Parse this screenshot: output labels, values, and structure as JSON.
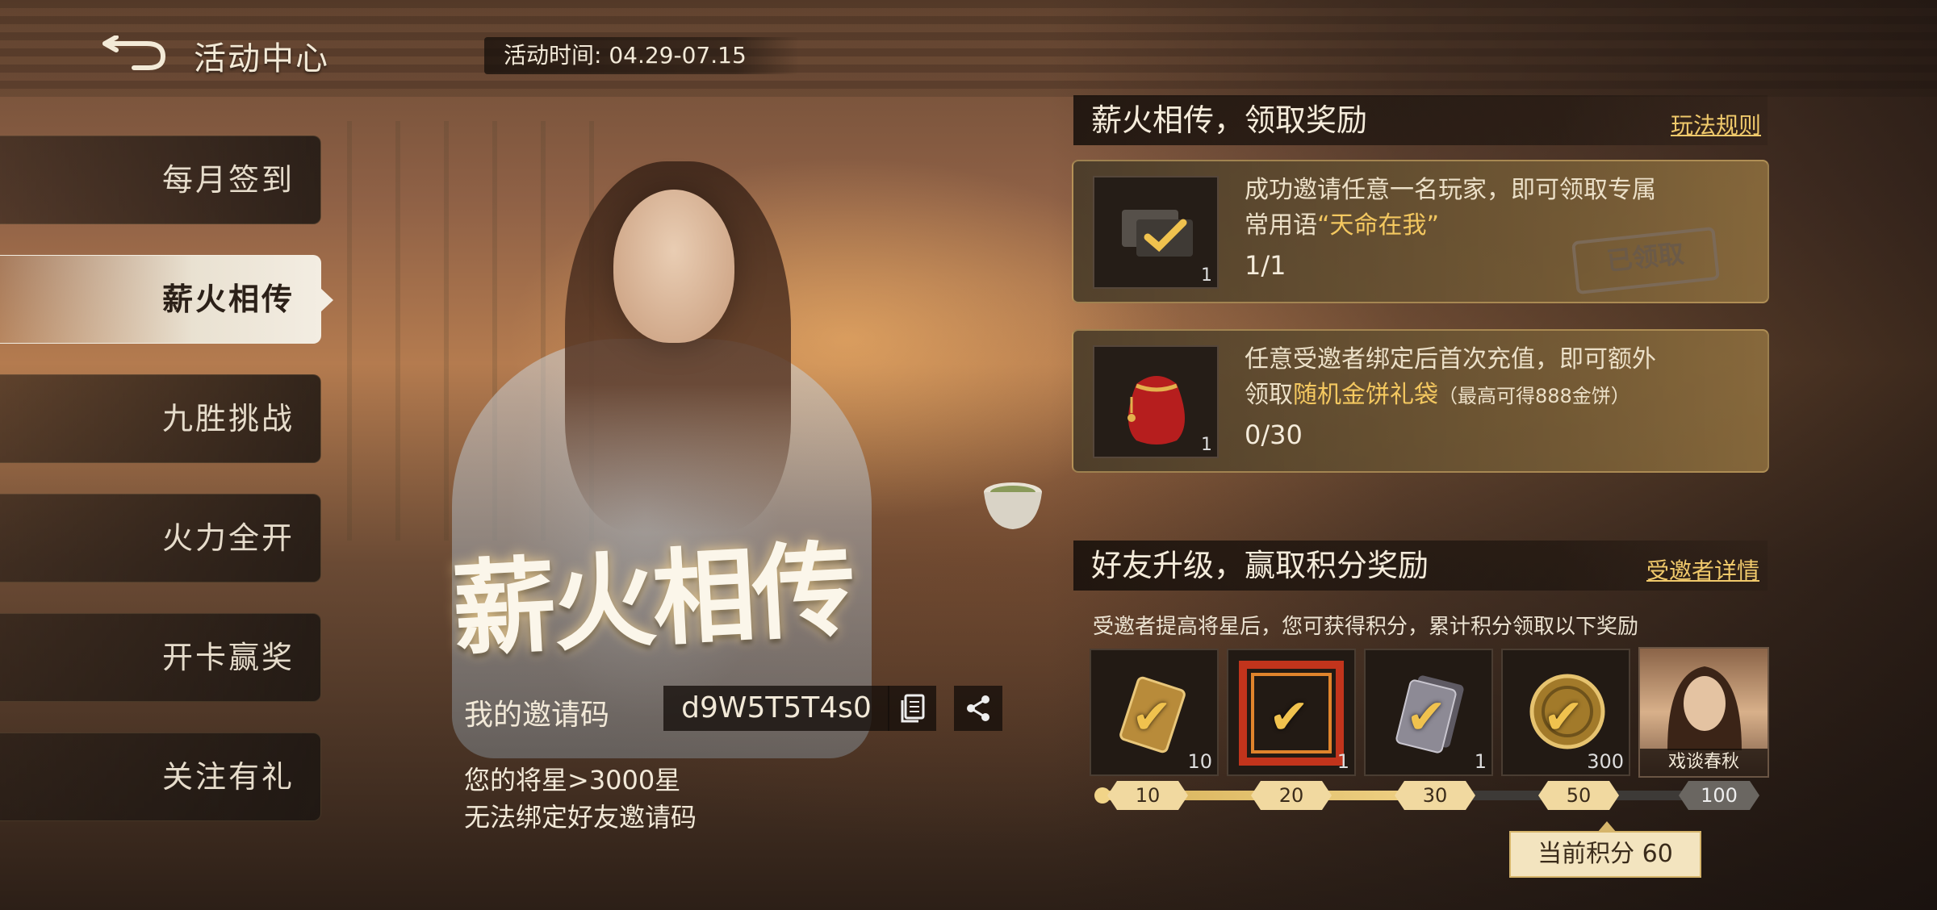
{
  "header": {
    "title": "活动中心",
    "time_text": "活动时间: 04.29-07.15"
  },
  "sidebar": {
    "items": [
      {
        "label": "每月签到",
        "active": false
      },
      {
        "label": "薪火相传",
        "active": true
      },
      {
        "label": "九胜挑战",
        "active": false
      },
      {
        "label": "火力全开",
        "active": false
      },
      {
        "label": "开卡赢奖",
        "active": false
      },
      {
        "label": "关注有礼",
        "active": false
      }
    ]
  },
  "hero": {
    "title": "薪火相传",
    "invite_label": "我的邀请码",
    "invite_code": "d9W5T5T4s0",
    "note_line1": "您的将星>3000星",
    "note_line2": "无法绑定好友邀请码"
  },
  "section1": {
    "title": "薪火相传，领取奖励",
    "rules_link": "玩法规则",
    "tasks": [
      {
        "desc_line1": "成功邀请任意一名玩家，即可领取专属",
        "desc_prefix": "常用语",
        "desc_highlight": "“天命在我”",
        "progress": "1/1",
        "icon_count": "1",
        "icon": "chat-check-icon",
        "status": "已领取"
      },
      {
        "desc_line1": "任意受邀者绑定后首次充值，即可额外",
        "desc_prefix": "领取",
        "desc_highlight": "随机金饼礼袋",
        "desc_note": "（最高可得888金饼）",
        "progress": "0/30",
        "icon_count": "1",
        "icon": "red-lucky-bag-icon"
      }
    ]
  },
  "section2": {
    "title": "好友升级，赢取积分奖励",
    "details_link": "受邀者详情",
    "desc": "受邀者提高将星后，您可获得积分，累计积分领取以下奖励",
    "rewards": [
      {
        "count": "10",
        "icon": "gold-card-icon",
        "claimed": true
      },
      {
        "count": "1",
        "icon": "flame-frame-icon",
        "claimed": true
      },
      {
        "count": "1",
        "icon": "card-stack-icon",
        "claimed": true
      },
      {
        "count": "300",
        "icon": "gold-coin-icon",
        "claimed": true
      },
      {
        "caption": "戏谈春秋",
        "icon": "hero-portrait-icon"
      }
    ],
    "milestones": [
      "10",
      "20",
      "30",
      "50",
      "100"
    ],
    "progress_fraction": 0.56,
    "current_score": "当前积分 60"
  },
  "colors": {
    "accent_gold": "#f0c96b",
    "highlight_gold": "#f4c860",
    "active_tab_bg": "#f3ede2"
  }
}
